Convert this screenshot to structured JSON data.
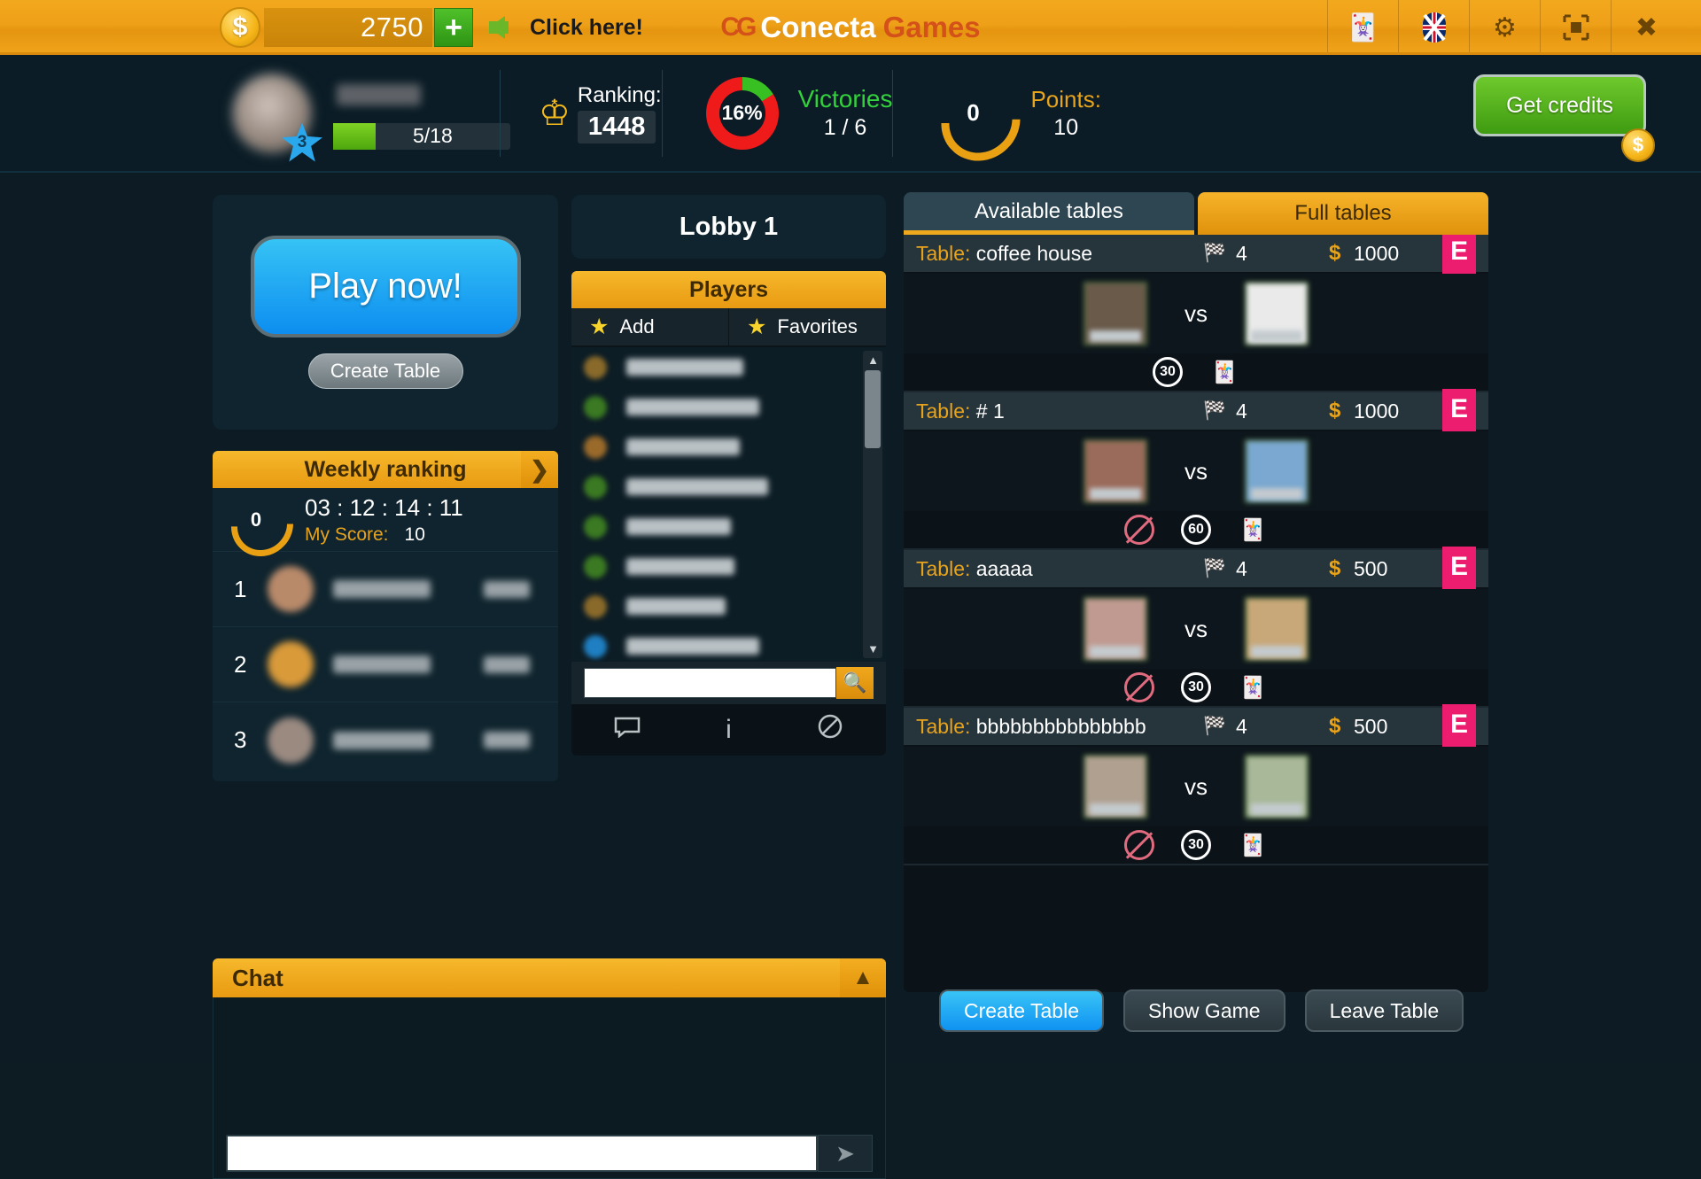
{
  "topbar": {
    "coin_icon": "dollar-coin-icon",
    "credits": "2750",
    "plus_label": "+",
    "click_here": "Click here!",
    "brand_logo": "CG",
    "brand_first": "Conecta",
    "brand_second": "Games",
    "icons": [
      {
        "name": "cards-icon",
        "glyph": "🃏"
      },
      {
        "name": "flag-uk-icon",
        "glyph": "⚑"
      },
      {
        "name": "settings-gear-icon",
        "glyph": "⚙"
      },
      {
        "name": "fullscreen-icon",
        "glyph": "⛶"
      },
      {
        "name": "close-icon",
        "glyph": "✖"
      }
    ]
  },
  "stats": {
    "level": "3",
    "xp": "5/18",
    "ranking_label": "Ranking:",
    "ranking_value": "1448",
    "victories_pct": "16%",
    "victories_label": "Victories",
    "victories_value": "1 / 6",
    "laurel_value": "0",
    "points_label": "Points:",
    "points_value": "10",
    "get_credits": "Get credits"
  },
  "left": {
    "play_now": "Play now!",
    "create_table": "Create Table",
    "weekly_title": "Weekly ranking",
    "weekly_arrow": "❯",
    "my_laurel": "0",
    "timer": "03 : 12 : 14 : 11",
    "my_score_label": "My Score:",
    "my_score_value": "10",
    "ranks": [
      {
        "pos": "1",
        "avatar_color": "#b98a6a"
      },
      {
        "pos": "2",
        "avatar_color": "#d99a3a"
      },
      {
        "pos": "3",
        "avatar_color": "#9a8a80"
      }
    ],
    "chat_title": "Chat",
    "chat_collapse": "▲",
    "chat_send": "➤"
  },
  "middle": {
    "lobby_title": "Lobby 1",
    "players_title": "Players",
    "add_label": "Add",
    "favorites_label": "Favorites",
    "player_dots": [
      "#8a6a2a",
      "#3b7a22",
      "#9a6a2a",
      "#3b7a22",
      "#3b7a22",
      "#3b7a22",
      "#8a6a2a",
      "#1f7fc2"
    ],
    "player_name_widths": [
      132,
      150,
      128,
      160,
      118,
      122,
      112,
      150
    ],
    "scroll_up": "▲",
    "scroll_down": "▼",
    "search_icon": "🔍",
    "footer_icons": [
      {
        "name": "chat-bubble-icon",
        "glyph": "▭"
      },
      {
        "name": "info-icon",
        "glyph": "i"
      },
      {
        "name": "block-icon",
        "glyph": "⃠"
      }
    ]
  },
  "right": {
    "tab_available": "Available tables",
    "tab_full": "Full tables",
    "table_prefix": "Table:",
    "tables": [
      {
        "name": "coffee house",
        "players": "4",
        "money": "1000",
        "badge": "E",
        "p1_color": "#6a5a4a",
        "p2_color": "#eaeaea",
        "options": [
          {
            "name": "timer-30-icon",
            "label": "30"
          },
          {
            "name": "joker-icon",
            "label": "🃏"
          }
        ]
      },
      {
        "name": "# 1",
        "players": "4",
        "money": "1000",
        "badge": "E",
        "p1_color": "#9a6a5a",
        "p2_color": "#7aa8d0",
        "options": [
          {
            "name": "no-chat-icon",
            "label": ""
          },
          {
            "name": "timer-60-icon",
            "label": "60"
          },
          {
            "name": "joker-icon",
            "label": "🃏"
          }
        ]
      },
      {
        "name": "aaaaa",
        "players": "4",
        "money": "500",
        "badge": "E",
        "p1_color": "#c09a90",
        "p2_color": "#c8a878",
        "options": [
          {
            "name": "no-chat-icon",
            "label": ""
          },
          {
            "name": "timer-30-icon",
            "label": "30"
          },
          {
            "name": "joker-icon",
            "label": "🃏"
          }
        ]
      },
      {
        "name": "bbbbbbbbbbbbbbb",
        "players": "4",
        "money": "500",
        "badge": "E",
        "p1_color": "#b0a090",
        "p2_color": "#a8b898",
        "options": [
          {
            "name": "no-chat-icon",
            "label": ""
          },
          {
            "name": "timer-30-icon",
            "label": "30"
          },
          {
            "name": "joker-icon",
            "label": "🃏"
          }
        ]
      }
    ],
    "btn_create": "Create Table",
    "btn_show": "Show Game",
    "btn_leave": "Leave Table"
  }
}
